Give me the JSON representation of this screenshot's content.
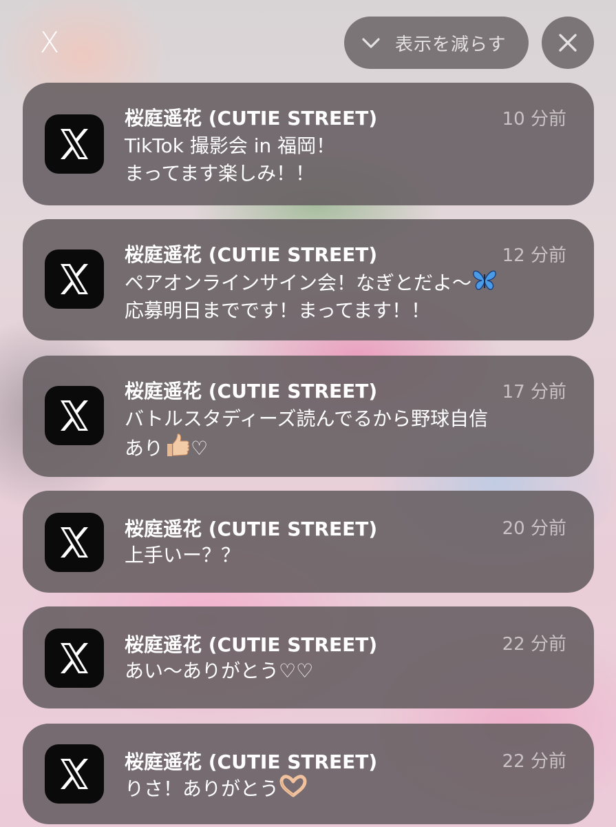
{
  "header": {
    "close_glyph": "X",
    "show_less_label": "表示を減らす"
  },
  "notifications": [
    {
      "app_icon": "x-app-icon",
      "sender": "桜庭遥花 (CUTIE STREET)",
      "time": "10 分前",
      "lines": [
        "TikTok 撮影会 in 福岡！",
        "まってます楽しみ！！"
      ]
    },
    {
      "app_icon": "x-app-icon",
      "sender": "桜庭遥花 (CUTIE STREET)",
      "time": "12 分前",
      "lines": [
        "ペアオンラインサイン会！なぎとだよ〜",
        "応募明日までです！まってます！！"
      ]
    },
    {
      "app_icon": "x-app-icon",
      "sender": "桜庭遥花 (CUTIE STREET)",
      "time": "17 分前",
      "lines": [
        "バトルスタディーズ読んでるから野球自信",
        "あり"
      ]
    },
    {
      "app_icon": "x-app-icon",
      "sender": "桜庭遥花 (CUTIE STREET)",
      "time": "20 分前",
      "lines": [
        "上手いー？？"
      ]
    },
    {
      "app_icon": "x-app-icon",
      "sender": "桜庭遥花 (CUTIE STREET)",
      "time": "22 分前",
      "lines": [
        "あい〜ありがとう♡♡"
      ]
    },
    {
      "app_icon": "x-app-icon",
      "sender": "桜庭遥花 (CUTIE STREET)",
      "time": "22 分前",
      "lines": [
        "りさ！ありがとう"
      ]
    }
  ],
  "emoji": {
    "n2_line1": "butterfly-emoji",
    "n3_line2": [
      "thumbs-up-emoji",
      "♡"
    ],
    "n6_line1": "heart-hands-emoji"
  },
  "colors": {
    "card_bg": "#686064",
    "pill_bg": "#6e686a",
    "icon_bg": "#0a0a0a",
    "text": "#ffffff",
    "time_text": "#c9c3c6"
  }
}
